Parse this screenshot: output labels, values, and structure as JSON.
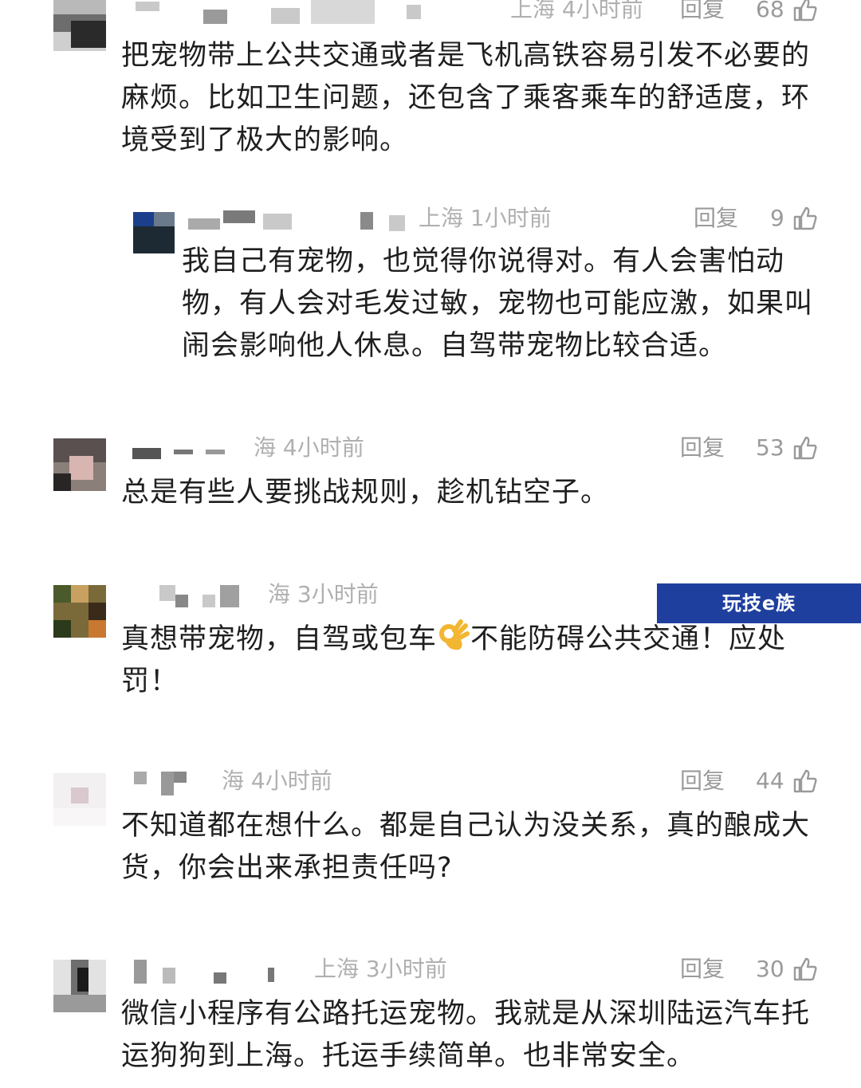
{
  "comments": [
    {
      "location": "上海 4小时前",
      "reply": "回复",
      "likes": "68",
      "text": "把宠物带上公共交通或者是飞机高铁容易引发不必要的麻烦。比如卫生问题，还包含了乘客乘车的舒适度，环境受到了极大的影响。"
    },
    {
      "location": "上海 1小时前",
      "reply": "回复",
      "likes": "9",
      "text": "我自己有宠物，也觉得你说得对。有人会害怕动物，有人会对毛发过敏，宠物也可能应激，如果叫闹会影响他人休息。自驾带宠物比较合适。"
    },
    {
      "location": "海 4小时前",
      "reply": "回复",
      "likes": "53",
      "text": "总是有些人要挑战规则，趁机钻空子。"
    },
    {
      "location": "海 3小时前",
      "reply": "回复",
      "likes": "",
      "text_before": "真想带宠物，自驾或包车",
      "text_after": "不能防碍公共交通！应处罚！"
    },
    {
      "location": "海 4小时前",
      "reply": "回复",
      "likes": "44",
      "text": "不知道都在想什么。都是自己认为没关系，真的酿成大货，你会出来承担责任吗?"
    },
    {
      "location": "上海 3小时前",
      "reply": "回复",
      "likes": "30",
      "text": "微信小程序有公路托运宠物。我就是从深圳陆运汽车托运狗狗到上海。托运手续简单。也非常安全。"
    }
  ],
  "watermark": "玩技e族",
  "icons": {
    "like": "thumbs-up-icon",
    "ok_emoji": "ok-hand-emoji-icon"
  },
  "colors": {
    "meta": "#a8a8a8",
    "text": "#1f1f1f",
    "watermark_bg": "#1f3f9e"
  }
}
